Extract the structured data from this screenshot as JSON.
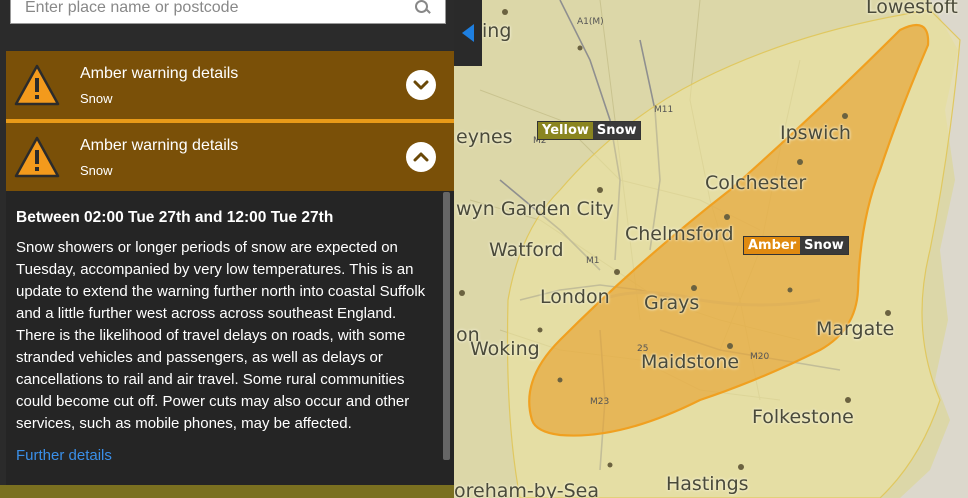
{
  "search": {
    "placeholder": "Enter place name or postcode",
    "icon": "search-icon"
  },
  "warnings": [
    {
      "title": "Amber warning details",
      "type": "Snow",
      "expanded": false,
      "icon": "warning-triangle-icon"
    },
    {
      "title": "Amber warning details",
      "type": "Snow",
      "expanded": true,
      "icon": "warning-triangle-icon"
    }
  ],
  "details": {
    "period": "Between 02:00 Tue 27th and 12:00 Tue 27th",
    "body": "Snow showers or longer periods of snow are expected on Tuesday, accompanied by very low temperatures. This is an update to extend the warning further north into coastal Suffolk and a little further west across across southeast England. There is the likelihood of travel delays on roads, with some stranded vehicles and passengers, as well as delays or cancellations to rail and air travel. Some rural communities could become cut off. Power cuts may also occur and other services, such as mobile phones, may be affected.",
    "further_link": "Further details"
  },
  "map": {
    "places": [
      "Lowestoft",
      "Ipswich",
      "Colchester",
      "Chelmsford",
      "Watford",
      "London",
      "Grays",
      "Margate",
      "Woking",
      "Maidstone",
      "Folkestone",
      "Hastings",
      "oreham-by-Sea",
      "ing",
      "eynes",
      "wyn Garden City",
      "on"
    ],
    "roads": [
      "A1(M)",
      "M11",
      "M1",
      "M20",
      "M23",
      "M2",
      "25"
    ],
    "badges": [
      {
        "level": "Yellow",
        "type": "Snow"
      },
      {
        "level": "Amber",
        "type": "Snow"
      }
    ],
    "colors": {
      "yellow_area": "#ece3a0",
      "amber_area": "#e69f2c",
      "amber_border": "#f0a020"
    }
  }
}
